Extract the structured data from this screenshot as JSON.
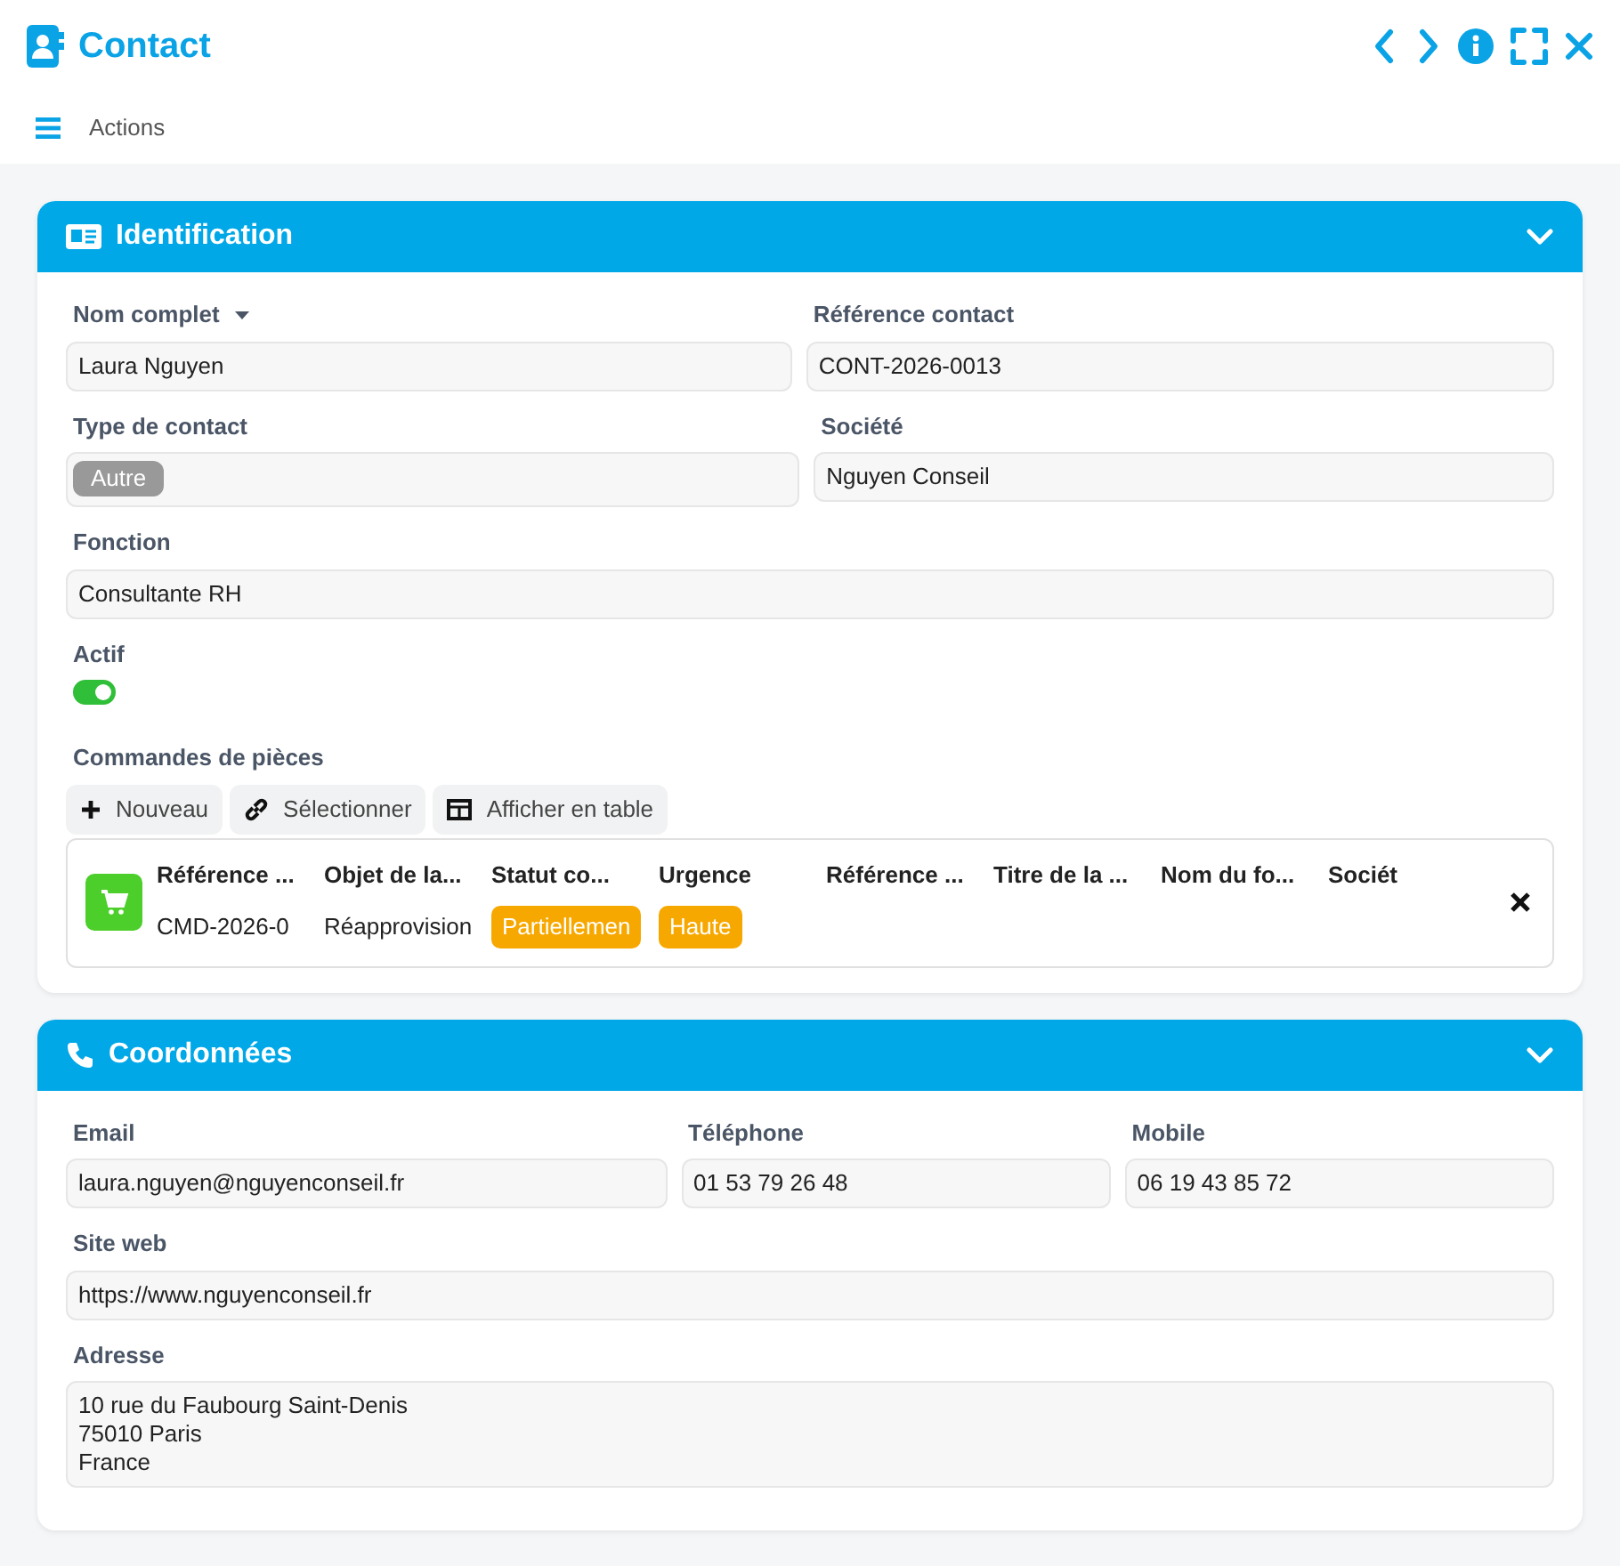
{
  "window": {
    "title": "Contact"
  },
  "toolbar": {
    "menu_label": "Actions"
  },
  "identification": {
    "title": "Identification",
    "expanded": true,
    "rows": [
      [
        {
          "kind": "text",
          "label": "Nom complet",
          "sort_caret": true,
          "value": "Laura Nguyen"
        },
        {
          "kind": "text",
          "label": "Référence contact",
          "value": "CONT-2026-0013"
        }
      ],
      [
        {
          "kind": "tag",
          "label": "Type de contact",
          "value": "Autre"
        },
        {
          "kind": "text",
          "label": "Société",
          "value": "Nguyen Conseil"
        }
      ],
      [
        {
          "kind": "text",
          "label": "Fonction",
          "value": "Consultante RH"
        }
      ],
      [
        {
          "kind": "switch",
          "label": "Actif",
          "on": true
        }
      ]
    ],
    "orders": {
      "label": "Commandes de pièces",
      "buttons": [
        {
          "label": "Nouveau"
        },
        {
          "label": "Sélectionner"
        },
        {
          "label": "Afficher en table"
        }
      ],
      "columns": [
        "Référence ...",
        "Objet de la...",
        "Statut co...",
        "Urgence",
        "Référence ...",
        "Titre de la ...",
        "Nom du fo...",
        "Sociét"
      ],
      "rows": [
        {
          "cells": [
            {
              "kind": "text",
              "text": "CMD-2026-0"
            },
            {
              "kind": "text",
              "text": "Réapprovision"
            },
            {
              "kind": "badge",
              "text": "Partiellemen",
              "color": "#f7a800"
            },
            {
              "kind": "badge",
              "text": "Haute",
              "color": "#f7a800"
            }
          ]
        }
      ]
    }
  },
  "coordonnees": {
    "title": "Coordonnées",
    "expanded": true,
    "rows": [
      [
        {
          "kind": "text",
          "label": "Email",
          "value": "laura.nguyen@nguyenconseil.fr"
        },
        {
          "kind": "text",
          "label": "Téléphone",
          "value": "01 53 79 26 48"
        },
        {
          "kind": "text",
          "label": "Mobile",
          "value": "06 19 43 85 72"
        }
      ],
      [
        {
          "kind": "text",
          "label": "Site web",
          "value": "https://www.nguyenconseil.fr"
        }
      ],
      [
        {
          "kind": "multiline",
          "label": "Adresse",
          "value": "10 rue du Faubourg Saint-Denis\n75010 Paris\nFrance"
        }
      ]
    ]
  }
}
